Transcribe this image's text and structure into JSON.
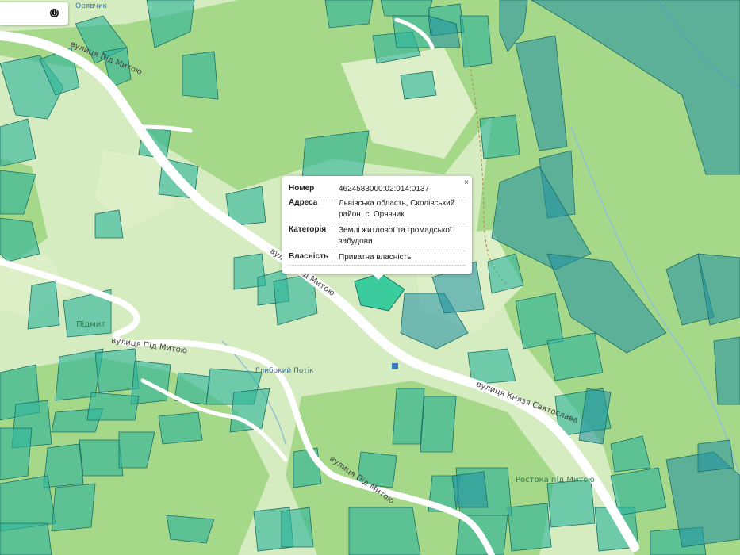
{
  "colors": {
    "background": "#d4ecc0",
    "forest": "#a6d88a",
    "meadow": "#d9efc5",
    "road": "#ffffff",
    "parcel_fill": "#2fb59b",
    "parcel_stroke": "#1b6e63",
    "parcel_dark": "#1f8fa3",
    "selected_parcel": "#2ac99a"
  },
  "search": {
    "info_icon": "ⓘ"
  },
  "popup": {
    "close": "×",
    "rows": [
      {
        "key": "Номер",
        "value": "4624583000:02:014:0137"
      },
      {
        "key": "Адреса",
        "value": "Львівська область, Сколівський район, с. Орявчик"
      },
      {
        "key": "Категорія",
        "value": "Землі житлової та громадської забудови"
      },
      {
        "key": "Власність",
        "value": "Приватна власність"
      }
    ]
  },
  "labels": {
    "street_top": "вулиця Під Митою",
    "street_middle": "вулиця Під Митою",
    "street_left": "вулиця Під Митою",
    "street_bottom": "вулиця Під Митою",
    "street_kniaz": "вулиця Князя Святослава",
    "place_glybokyi": "Глибокий Потік",
    "place_rozstoka": "Ростока під Митою",
    "place_pidmyt": "Підмит",
    "place_top": "Орявчик"
  }
}
